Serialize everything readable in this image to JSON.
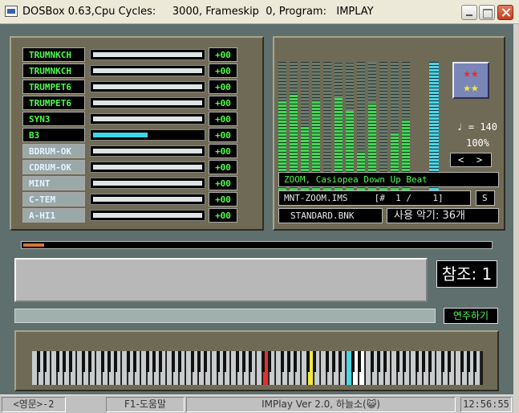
{
  "window": {
    "title": "DOSBox 0.63,Cpu Cycles:     3000, Frameskip  0, Program:   IMPLAY"
  },
  "channels": [
    {
      "name": "TRUMNKCH",
      "value": "+00",
      "level": 0.0,
      "style": "black"
    },
    {
      "name": "TRUMNKCH",
      "value": "+00",
      "level": 0.0,
      "style": "black"
    },
    {
      "name": "TRUMPET6",
      "value": "+00",
      "level": 0.0,
      "style": "black"
    },
    {
      "name": "TRUMPET6",
      "value": "+00",
      "level": 0.0,
      "style": "black"
    },
    {
      "name": "SYN3",
      "value": "+00",
      "level": 0.0,
      "style": "black"
    },
    {
      "name": "B3",
      "value": "+00",
      "level": 0.5,
      "style": "black"
    },
    {
      "name": "BDRUM-OK",
      "value": "+00",
      "level": 0.0,
      "style": "alt"
    },
    {
      "name": "CDRUM-OK",
      "value": "+00",
      "level": 0.0,
      "style": "alt"
    },
    {
      "name": "MINT",
      "value": "+00",
      "level": 0.0,
      "style": "alt"
    },
    {
      "name": "C-TEM",
      "value": "+00",
      "level": 0.0,
      "style": "alt"
    },
    {
      "name": "A-HI1",
      "value": "+00",
      "level": 0.0,
      "style": "alt"
    }
  ],
  "vu_levels": [
    0.7,
    0.75,
    0.5,
    0.7,
    0.1,
    0.72,
    0.62,
    0.3,
    0.68,
    0.1,
    0.45,
    0.55
  ],
  "tempo": {
    "text": "♩ = 140",
    "percent": "100%"
  },
  "nav": {
    "prev": "<",
    "next": ">"
  },
  "song": {
    "title": "ZOOM, Casiopea Down Up Beat",
    "file": "MNT-ZOOM.IMS     [#  1 /    1]",
    "mode": "S",
    "bank": "STANDARD.BNK",
    "instruments": "사용 악기: 36개"
  },
  "progress": 0.045,
  "ref": {
    "label": "참조: 1"
  },
  "play_button": "연주하기",
  "status": {
    "lang": "<영문>-2",
    "help": "F1-도움말",
    "app": "IMPlay Ver 2.0, 하늘소(😺)",
    "time": "12:56:55"
  },
  "pressed_keys": [
    {
      "index": 36,
      "color": "#e03030"
    },
    {
      "index": 43,
      "color": "#f2e83a"
    },
    {
      "index": 49,
      "color": "#4fd4e0"
    },
    {
      "index": 50,
      "color": "#ffffff"
    },
    {
      "index": 51,
      "color": "#ffffff"
    }
  ],
  "colors": {
    "accent_green": "#4cff4c",
    "progress_orange": "#d2763a"
  }
}
